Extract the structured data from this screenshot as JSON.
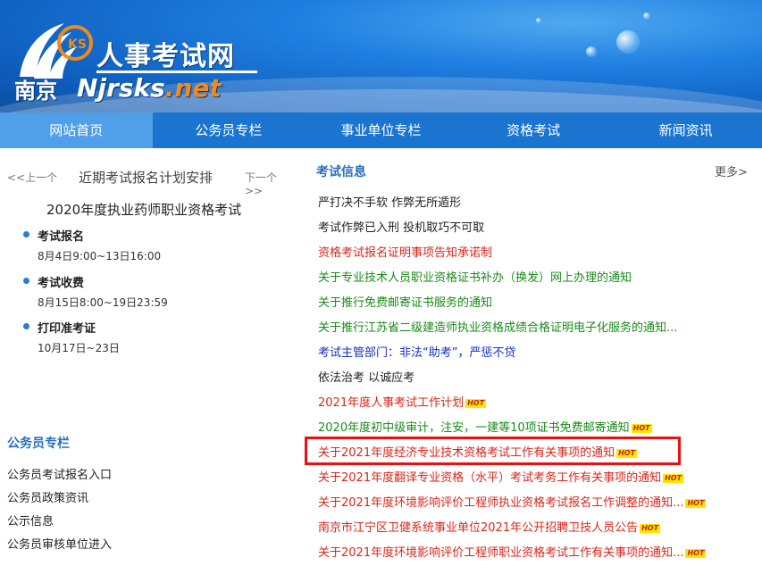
{
  "header": {
    "site_title": "人事考试网",
    "logo_city": "南京",
    "logo_domain": "Njrsks",
    "logo_domain_suffix": ".net",
    "logo_letters": "KS"
  },
  "nav": {
    "items": [
      "网站首页",
      "公务员专栏",
      "事业单位专栏",
      "资格考试",
      "新闻资讯"
    ]
  },
  "carousel": {
    "prev": "<<上一个",
    "title": "近期考试报名计划安排",
    "next": "下一个>>",
    "exam_name": "2020年度执业药师职业资格考试",
    "steps": [
      {
        "title": "考试报名",
        "date": "8月4日9:00~13日16:00"
      },
      {
        "title": "考试收费",
        "date": "8月15日8:00~19日23:59"
      },
      {
        "title": "打印准考证",
        "date": "10月17日~23日"
      }
    ]
  },
  "gwy": {
    "title": "公务员专栏",
    "items": [
      "公务员考试报名入口",
      "公务员政策资讯",
      "公示信息",
      "公务员审核单位进入"
    ]
  },
  "news": {
    "title": "考试信息",
    "more": "更多>",
    "hot_label": "HOT",
    "items": [
      {
        "text": "严打决不手软 作弊无所遁形",
        "color": "black"
      },
      {
        "text": "考试作弊已入刑 投机取巧不可取",
        "color": "black"
      },
      {
        "text": "资格考试报名证明事项告知承诺制",
        "color": "red"
      },
      {
        "text": "关于专业技术人员职业资格证书补办（换发）网上办理的通知",
        "color": "green"
      },
      {
        "text": "关于推行免费邮寄证书服务的通知",
        "color": "green"
      },
      {
        "text": "关于推行江苏省二级建造师执业资格成绩合格证明电子化服务的通知...",
        "color": "green"
      },
      {
        "text": "考试主管部门：非法“助考”，严惩不贷",
        "color": "blue"
      },
      {
        "text": "依法治考 以诚应考",
        "color": "black"
      },
      {
        "text": "2021年度人事考试工作计划",
        "color": "red",
        "hot": true
      },
      {
        "text": "2020年度初中级审计，注安，一建等10项证书免费邮寄通知",
        "color": "green",
        "hot": true
      },
      {
        "text": "关于2021年度经济专业技术资格考试工作有关事项的通知",
        "color": "red",
        "hot": true
      },
      {
        "text": "关于2021年度翻译专业资格（水平）考试考务工作有关事项的通知",
        "color": "red",
        "hot": true
      },
      {
        "text": "关于2021年度环境影响评价工程师执业资格考试报名工作调整的通知...",
        "color": "red",
        "hot": true
      },
      {
        "text": "南京市江宁区卫健系统事业单位2021年公开招聘卫技人员公告",
        "color": "red",
        "hot": true
      },
      {
        "text": "关于2021年度环境影响评价工程师职业资格考试工作有关事项的通知...",
        "color": "red",
        "hot": true
      }
    ]
  },
  "colors": {
    "nav_bg": "#1b75d0",
    "nav_active": "#4f9fe9",
    "section_title": "#2a6fbf",
    "highlight": "#e81010",
    "hot_bg": "#ffe600"
  }
}
